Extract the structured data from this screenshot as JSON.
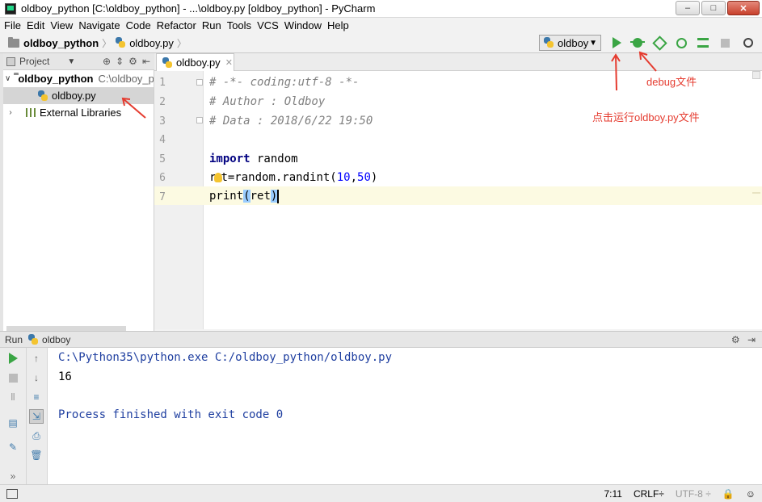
{
  "window": {
    "title": "oldboy_python [C:\\oldboy_python] - ...\\oldboy.py [oldboy_python] - PyCharm",
    "controls": [
      "–",
      "□",
      "✕"
    ]
  },
  "menu": [
    "File",
    "Edit",
    "View",
    "Navigate",
    "Code",
    "Refactor",
    "Run",
    "Tools",
    "VCS",
    "Window",
    "Help"
  ],
  "navbar": {
    "project": "oldboy_python",
    "file": "oldboy.py"
  },
  "toolbar": {
    "run_config": "oldboy"
  },
  "project_panel": {
    "header": "Project",
    "root_name": "oldboy_python",
    "root_path": "C:\\oldboy_python",
    "file": "oldboy.py",
    "libraries": "External Libraries"
  },
  "editor": {
    "tab": "oldboy.py",
    "line_numbers": [
      "1",
      "2",
      "3",
      "4",
      "5",
      "6",
      "7"
    ],
    "lines": {
      "l1": "# -*- coding:utf-8 -*-",
      "l2": "# Author : Oldboy",
      "l3": "# Data : 2018/6/22 19:50",
      "l5_kw": "import",
      "l5_rest": " random",
      "l6_a": "r",
      "l6_b": "t=random.randint(",
      "l6_n1": "10",
      "l6_c": ",",
      "l6_n2": "50",
      "l6_d": ")",
      "l7_a": "print",
      "l7_b": "(",
      "l7_c": "ret",
      "l7_d": ")"
    }
  },
  "annotations": {
    "debug": "debug文件",
    "run": "点击运行oldboy.py文件"
  },
  "run_panel": {
    "label": "Run",
    "config": "oldboy",
    "console": {
      "cmd": "C:\\Python35\\python.exe C:/oldboy_python/oldboy.py",
      "output": "16",
      "finished": "Process finished with exit code 0"
    }
  },
  "status": {
    "position": "7:11",
    "line_sep": "CRLF÷",
    "encoding": "UTF-8 ÷"
  },
  "colors": {
    "accent_run": "#3aa544",
    "annotation": "#e53b2f"
  }
}
